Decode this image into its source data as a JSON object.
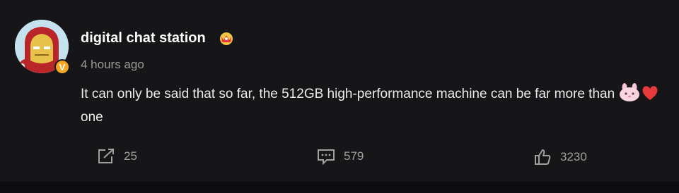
{
  "comment": {
    "username": "digital chat station",
    "verified_badge": "V",
    "timestamp": "4 hours ago",
    "text_before": "It can only be said that so far, the 512GB high-performance machine can be far more than",
    "text_after": "one",
    "emojis": [
      "rabbit-face-emoji",
      "red-heart-emoji"
    ]
  },
  "actions": {
    "share_count": "25",
    "comment_count": "579",
    "like_count": "3230"
  },
  "colors": {
    "background": "#161619",
    "text": "#ececec",
    "muted": "#9a9a9a",
    "badge": "#f5a623",
    "heart": "#e8393b"
  }
}
